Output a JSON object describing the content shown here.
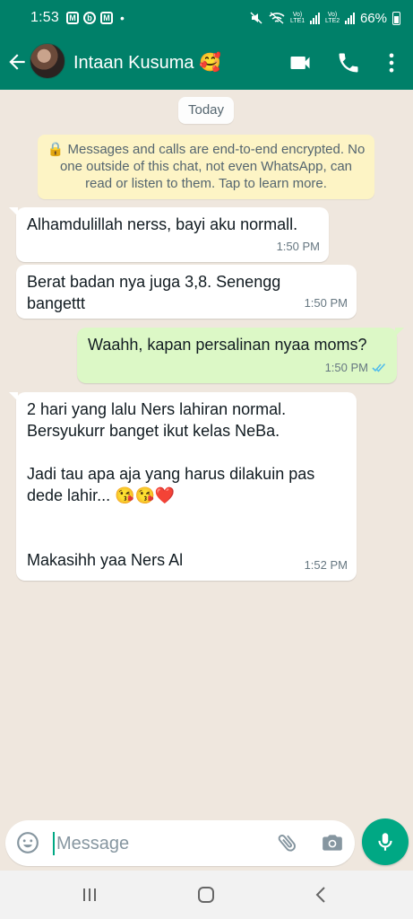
{
  "status_bar": {
    "time": "1:53",
    "dot": "•",
    "lte1": "Vo) LTE1",
    "lte2": "Vo) LTE2",
    "battery": "66%",
    "notification_icons": [
      "gmail-icon",
      "messenger-icon",
      "gmail-icon"
    ]
  },
  "header": {
    "contact_name": "Intaan Kusuma 🥰",
    "icons": [
      "back-arrow-icon",
      "video-call-icon",
      "voice-call-icon",
      "more-options-icon"
    ]
  },
  "chat": {
    "date_chip": "Today",
    "encryption_notice": "🔒 Messages and calls are end-to-end encrypted. No one outside of this chat, not even WhatsApp, can read or listen to them. Tap to learn more.",
    "messages": [
      {
        "direction": "incoming",
        "text": "Alhamdulillah nerss, bayi aku normall.",
        "time": "1:50 PM"
      },
      {
        "direction": "incoming",
        "text": "Berat badan nya juga 3,8. Senengg bangettt",
        "time": "1:50 PM"
      },
      {
        "direction": "outgoing",
        "text": "Waahh, kapan persalinan nyaa moms?",
        "time": "1:50 PM",
        "status": "read"
      },
      {
        "direction": "incoming",
        "text": "2 hari yang lalu Ners lahiran normal. Bersyukurr banget ikut kelas NeBa.\n\nJadi tau apa aja yang harus dilakuin pas dede lahir... 😘😘❤️\n\n\nMakasihh yaa Ners Al",
        "time": "1:52 PM"
      }
    ]
  },
  "composer": {
    "placeholder": "Message",
    "value": ""
  },
  "colors": {
    "header": "#008069",
    "outgoing_bubble": "#dcf8c6",
    "incoming_bubble": "#ffffff",
    "accent": "#00a884",
    "encryption_bg": "#fdf4c5",
    "chat_bg": "#efe7de"
  }
}
